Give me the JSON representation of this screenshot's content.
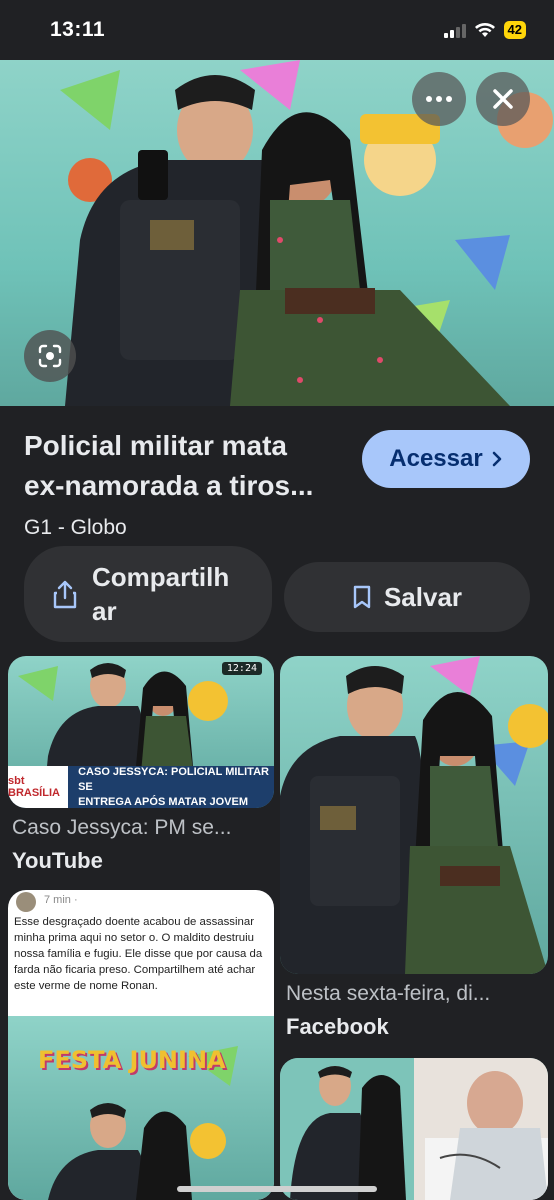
{
  "status": {
    "time": "13:11",
    "battery": "42"
  },
  "hero": {
    "more_icon": "more-horizontal-icon",
    "close_icon": "close-icon",
    "lens_icon": "lens-icon"
  },
  "result": {
    "title_line1": "Policial militar mata",
    "title_line2": "ex-namorada a tiros...",
    "source": "G1 - Globo",
    "access_label": "Acessar"
  },
  "actions": {
    "share_label_line1": "Compartilh",
    "share_label_line2": "ar",
    "save_label": "Salvar"
  },
  "related": [
    {
      "duration": "12:24",
      "banner_logo": "sbt BRASÍLIA",
      "banner_line1": "CASO JESSYCA: POLICIAL MILITAR SE",
      "banner_line2": "ENTREGA APÓS MATAR JOVEM",
      "caption": "Caso Jessyca: PM se...",
      "source": "YouTube"
    },
    {
      "caption": "Nesta sexta-feira, di...",
      "source": "Facebook"
    }
  ],
  "facebook_post": {
    "time": "7 min · ",
    "text": "Esse desgraçado doente acabou de assassinar minha prima aqui no setor o. O maldito destruiu nossa família e fugiu. Ele disse que por causa da farda não ficaria preso. Compartilhem até achar este verme de nome Ronan.",
    "photo_text": "FESTA JUNINA"
  },
  "colors": {
    "background": "#202124",
    "accent": "#a8c7fa",
    "battery": "#ffd60a"
  }
}
